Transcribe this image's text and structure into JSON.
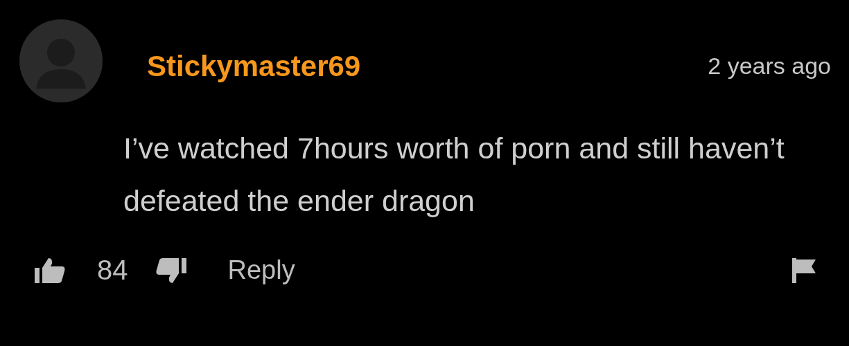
{
  "comment": {
    "author": "Stickymaster69",
    "time": "2 years ago",
    "text": "I’ve watched 7hours worth of porn and still haven’t defeated the ender dragon",
    "likes": "84",
    "reply": "Reply"
  }
}
